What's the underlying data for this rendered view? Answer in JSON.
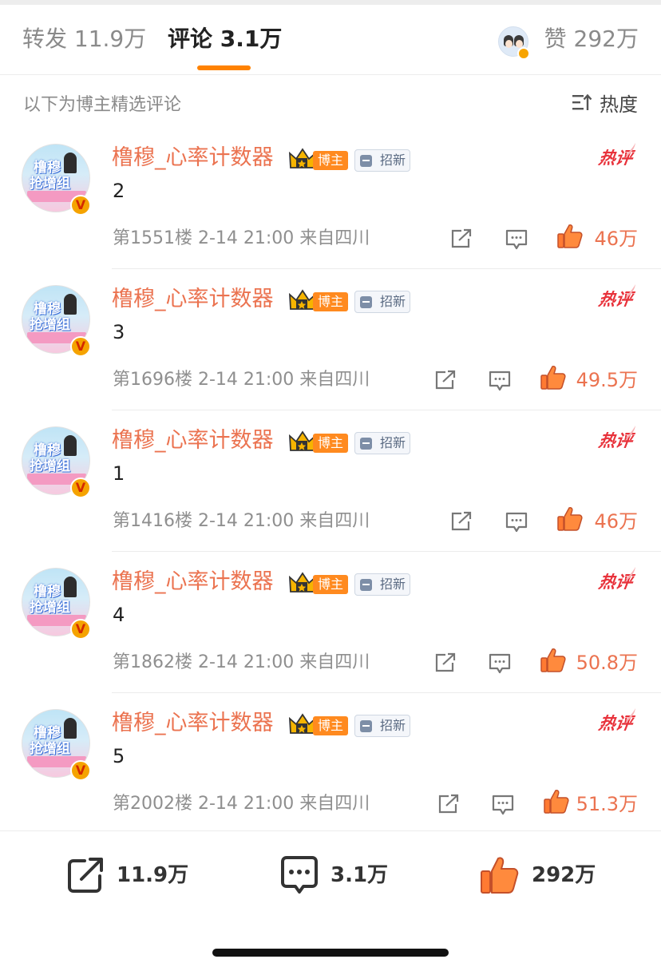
{
  "tabs": {
    "repost": "转发 11.9万",
    "comment": "评论 3.1万",
    "like": "赞 292万"
  },
  "section": {
    "title": "以下为博主精选评论",
    "sort_label": "热度"
  },
  "comments": [
    {
      "username": "橹穆_心率计数器",
      "badge": "博主",
      "tag": "招新",
      "hot": "热评",
      "content": "2",
      "meta": "第1551楼 2-14 21:00 来自四川",
      "likes": "46万"
    },
    {
      "username": "橹穆_心率计数器",
      "badge": "博主",
      "tag": "招新",
      "hot": "热评",
      "content": "3",
      "meta": "第1696楼 2-14 21:00 来自四川",
      "likes": "49.5万"
    },
    {
      "username": "橹穆_心率计数器",
      "badge": "博主",
      "tag": "招新",
      "hot": "热评",
      "content": "1",
      "meta": "第1416楼 2-14 21:00 来自四川",
      "likes": "46万"
    },
    {
      "username": "橹穆_心率计数器",
      "badge": "博主",
      "tag": "招新",
      "hot": "热评",
      "content": "4",
      "meta": "第1862楼 2-14 21:00 来自四川",
      "likes": "50.8万"
    },
    {
      "username": "橹穆_心率计数器",
      "badge": "博主",
      "tag": "招新",
      "hot": "热评",
      "content": "5",
      "meta": "第2002楼 2-14 21:00 来自四川",
      "likes": "51.3万"
    }
  ],
  "avatar_text": {
    "line1": "橹穆",
    "line2": "抢增组"
  },
  "bottom_bar": {
    "repost_count": "11.9万",
    "comment_count": "3.1万",
    "like_count": "292万"
  },
  "colors": {
    "accent": "#ff8200",
    "username": "#eb7350",
    "hot": "#e8323b"
  },
  "icons": [
    "sort-icon",
    "crown-icon",
    "document-icon",
    "share-icon",
    "reply-icon",
    "thumbs-up-icon",
    "verified-icon"
  ]
}
